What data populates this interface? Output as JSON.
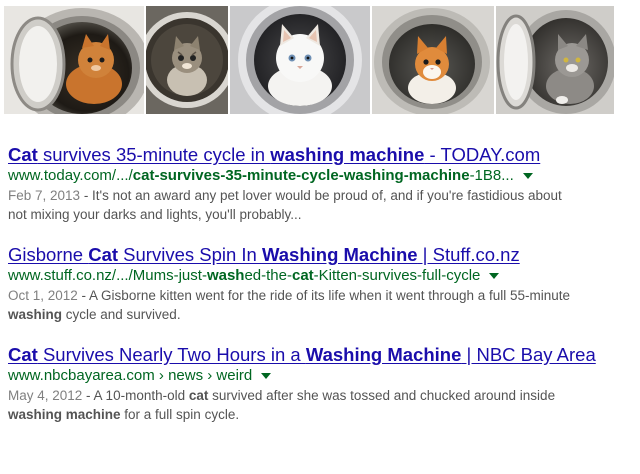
{
  "image_strip": {
    "thumbnails": [
      {
        "subject": "orange-kitten-in-washing-machine"
      },
      {
        "subject": "tabby-kitten-in-washing-machine"
      },
      {
        "subject": "white-fluffy-cat-in-washing-machine"
      },
      {
        "subject": "orange-white-kitten-in-washing-machine"
      },
      {
        "subject": "grey-cat-in-washing-machine"
      }
    ]
  },
  "results": [
    {
      "title_parts": [
        "Cat",
        " survives 35-minute cycle in ",
        "washing machine",
        " - TODAY.com"
      ],
      "url_parts": [
        "www.today.com/.../",
        "cat-survives-35-minute-cycle-washing-machine",
        "-1B8..."
      ],
      "date": "Feb 7, 2013",
      "snippet_line1": " - It's not an award any pet lover would be proud of, and if you're fastidious about",
      "snippet_line2": "not mixing your darks and lights, you'll probably..."
    },
    {
      "title_parts": [
        "Gisborne ",
        "Cat",
        " Survives Spin In ",
        "Washing Machine",
        " | Stuff.co.nz"
      ],
      "url_parts": [
        "www.stuff.co.nz/.../Mums-just-",
        "wash",
        "ed-the-",
        "cat",
        "-Kitten-survives-full-cycle"
      ],
      "date": "Oct 1, 2012",
      "snippet_line1": " - A Gisborne kitten went for the ride of its life when it went through a full 55-minute",
      "snippet_bold": "washing",
      "snippet_line2": " cycle and survived."
    },
    {
      "title_parts": [
        "Cat",
        " Survives Nearly Two Hours in a ",
        "Washing Machine",
        " | NBC Bay Area"
      ],
      "url_parts": [
        "www.nbcbayarea.com › news › weird"
      ],
      "date": "May 4, 2012",
      "snippet_line1a": " - A 10-month-old ",
      "snippet_bold1": "cat",
      "snippet_line1b": " survived after she was tossed and chucked around inside",
      "snippet_bold2": "washing machine",
      "snippet_line2": " for a full spin cycle."
    }
  ],
  "colors": {
    "link": "#1a0dab",
    "url": "#006621",
    "snippet": "#545454",
    "date": "#808080"
  }
}
